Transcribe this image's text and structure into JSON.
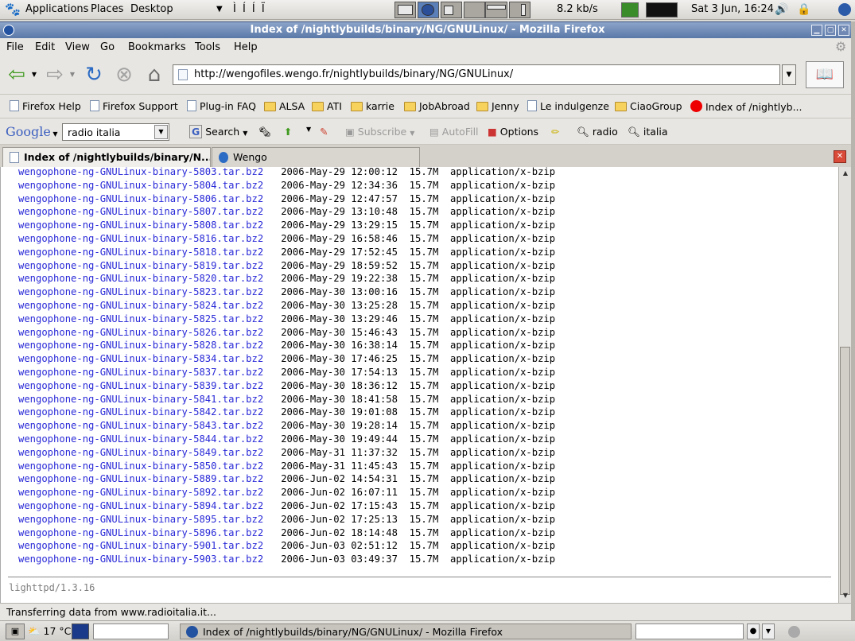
{
  "top_panel": {
    "menus": [
      "Applications",
      "Places",
      "Desktop"
    ],
    "glyphs": "Ì Í Í Ï",
    "net_speed": "8.2 kb/s",
    "datetime": "Sat  3 Jun, 16:24"
  },
  "window": {
    "title": "Index of /nightlybuilds/binary/NG/GNULinux/ - Mozilla Firefox"
  },
  "menubar": [
    "File",
    "Edit",
    "View",
    "Go",
    "Bookmarks",
    "Tools",
    "Help"
  ],
  "navigation": {
    "url": "http://wengofiles.wengo.fr/nightlybuilds/binary/NG/GNULinux/"
  },
  "bookmarks": [
    {
      "label": "Firefox Help",
      "icon": "page"
    },
    {
      "label": "Firefox Support",
      "icon": "page"
    },
    {
      "label": "Plug-in FAQ",
      "icon": "page"
    },
    {
      "label": "ALSA",
      "icon": "folder"
    },
    {
      "label": "ATI",
      "icon": "folder"
    },
    {
      "label": "karrie",
      "icon": "folder"
    },
    {
      "label": "JobAbroad",
      "icon": "folder"
    },
    {
      "label": "Jenny",
      "icon": "folder"
    },
    {
      "label": "Le indulgenze",
      "icon": "page"
    },
    {
      "label": "CiaoGroup",
      "icon": "folder"
    },
    {
      "label": "Index of /nightlyb...",
      "icon": "vodafone"
    }
  ],
  "google_toolbar": {
    "logo": "Google",
    "query": "radio italia",
    "search_label": "Search",
    "subscribe_label": "Subscribe",
    "autofill_label": "AutoFill",
    "options_label": "Options",
    "term1": "radio",
    "term2": "italia"
  },
  "tabs": [
    {
      "label": "Index of /nightlybuilds/binary/N...",
      "active": true
    },
    {
      "label": "Wengo",
      "active": false
    }
  ],
  "listing": {
    "rows": [
      {
        "name": "wengophone-ng-GNULinux-binary-5803.tar.bz2",
        "date": "2006-May-29 12:00:12",
        "size": "15.7M",
        "type": "application/x-bzip"
      },
      {
        "name": "wengophone-ng-GNULinux-binary-5804.tar.bz2",
        "date": "2006-May-29 12:34:36",
        "size": "15.7M",
        "type": "application/x-bzip"
      },
      {
        "name": "wengophone-ng-GNULinux-binary-5806.tar.bz2",
        "date": "2006-May-29 12:47:57",
        "size": "15.7M",
        "type": "application/x-bzip"
      },
      {
        "name": "wengophone-ng-GNULinux-binary-5807.tar.bz2",
        "date": "2006-May-29 13:10:48",
        "size": "15.7M",
        "type": "application/x-bzip"
      },
      {
        "name": "wengophone-ng-GNULinux-binary-5808.tar.bz2",
        "date": "2006-May-29 13:29:15",
        "size": "15.7M",
        "type": "application/x-bzip"
      },
      {
        "name": "wengophone-ng-GNULinux-binary-5816.tar.bz2",
        "date": "2006-May-29 16:58:46",
        "size": "15.7M",
        "type": "application/x-bzip"
      },
      {
        "name": "wengophone-ng-GNULinux-binary-5818.tar.bz2",
        "date": "2006-May-29 17:52:45",
        "size": "15.7M",
        "type": "application/x-bzip"
      },
      {
        "name": "wengophone-ng-GNULinux-binary-5819.tar.bz2",
        "date": "2006-May-29 18:59:52",
        "size": "15.7M",
        "type": "application/x-bzip"
      },
      {
        "name": "wengophone-ng-GNULinux-binary-5820.tar.bz2",
        "date": "2006-May-29 19:22:38",
        "size": "15.7M",
        "type": "application/x-bzip"
      },
      {
        "name": "wengophone-ng-GNULinux-binary-5823.tar.bz2",
        "date": "2006-May-30 13:00:16",
        "size": "15.7M",
        "type": "application/x-bzip"
      },
      {
        "name": "wengophone-ng-GNULinux-binary-5824.tar.bz2",
        "date": "2006-May-30 13:25:28",
        "size": "15.7M",
        "type": "application/x-bzip"
      },
      {
        "name": "wengophone-ng-GNULinux-binary-5825.tar.bz2",
        "date": "2006-May-30 13:29:46",
        "size": "15.7M",
        "type": "application/x-bzip"
      },
      {
        "name": "wengophone-ng-GNULinux-binary-5826.tar.bz2",
        "date": "2006-May-30 15:46:43",
        "size": "15.7M",
        "type": "application/x-bzip"
      },
      {
        "name": "wengophone-ng-GNULinux-binary-5828.tar.bz2",
        "date": "2006-May-30 16:38:14",
        "size": "15.7M",
        "type": "application/x-bzip"
      },
      {
        "name": "wengophone-ng-GNULinux-binary-5834.tar.bz2",
        "date": "2006-May-30 17:46:25",
        "size": "15.7M",
        "type": "application/x-bzip"
      },
      {
        "name": "wengophone-ng-GNULinux-binary-5837.tar.bz2",
        "date": "2006-May-30 17:54:13",
        "size": "15.7M",
        "type": "application/x-bzip"
      },
      {
        "name": "wengophone-ng-GNULinux-binary-5839.tar.bz2",
        "date": "2006-May-30 18:36:12",
        "size": "15.7M",
        "type": "application/x-bzip"
      },
      {
        "name": "wengophone-ng-GNULinux-binary-5841.tar.bz2",
        "date": "2006-May-30 18:41:58",
        "size": "15.7M",
        "type": "application/x-bzip"
      },
      {
        "name": "wengophone-ng-GNULinux-binary-5842.tar.bz2",
        "date": "2006-May-30 19:01:08",
        "size": "15.7M",
        "type": "application/x-bzip"
      },
      {
        "name": "wengophone-ng-GNULinux-binary-5843.tar.bz2",
        "date": "2006-May-30 19:28:14",
        "size": "15.7M",
        "type": "application/x-bzip"
      },
      {
        "name": "wengophone-ng-GNULinux-binary-5844.tar.bz2",
        "date": "2006-May-30 19:49:44",
        "size": "15.7M",
        "type": "application/x-bzip"
      },
      {
        "name": "wengophone-ng-GNULinux-binary-5849.tar.bz2",
        "date": "2006-May-31 11:37:32",
        "size": "15.7M",
        "type": "application/x-bzip"
      },
      {
        "name": "wengophone-ng-GNULinux-binary-5850.tar.bz2",
        "date": "2006-May-31 11:45:43",
        "size": "15.7M",
        "type": "application/x-bzip"
      },
      {
        "name": "wengophone-ng-GNULinux-binary-5889.tar.bz2",
        "date": "2006-Jun-02 14:54:31",
        "size": "15.7M",
        "type": "application/x-bzip"
      },
      {
        "name": "wengophone-ng-GNULinux-binary-5892.tar.bz2",
        "date": "2006-Jun-02 16:07:11",
        "size": "15.7M",
        "type": "application/x-bzip"
      },
      {
        "name": "wengophone-ng-GNULinux-binary-5894.tar.bz2",
        "date": "2006-Jun-02 17:15:43",
        "size": "15.7M",
        "type": "application/x-bzip"
      },
      {
        "name": "wengophone-ng-GNULinux-binary-5895.tar.bz2",
        "date": "2006-Jun-02 17:25:13",
        "size": "15.7M",
        "type": "application/x-bzip"
      },
      {
        "name": "wengophone-ng-GNULinux-binary-5896.tar.bz2",
        "date": "2006-Jun-02 18:14:48",
        "size": "15.7M",
        "type": "application/x-bzip"
      },
      {
        "name": "wengophone-ng-GNULinux-binary-5901.tar.bz2",
        "date": "2006-Jun-03 02:51:12",
        "size": "15.7M",
        "type": "application/x-bzip"
      },
      {
        "name": "wengophone-ng-GNULinux-binary-5903.tar.bz2",
        "date": "2006-Jun-03 03:49:37",
        "size": "15.7M",
        "type": "application/x-bzip"
      }
    ],
    "server_signature": "lighttpd/1.3.16"
  },
  "status_text": "Transferring data from www.radioitalia.it...",
  "bottom_panel": {
    "weather": "17 °C",
    "task_title": "Index of /nightlybuilds/binary/NG/GNULinux/ - Mozilla Firefox"
  },
  "colors": {
    "link": "#2929d8",
    "titlebar": "#5a78a8"
  }
}
